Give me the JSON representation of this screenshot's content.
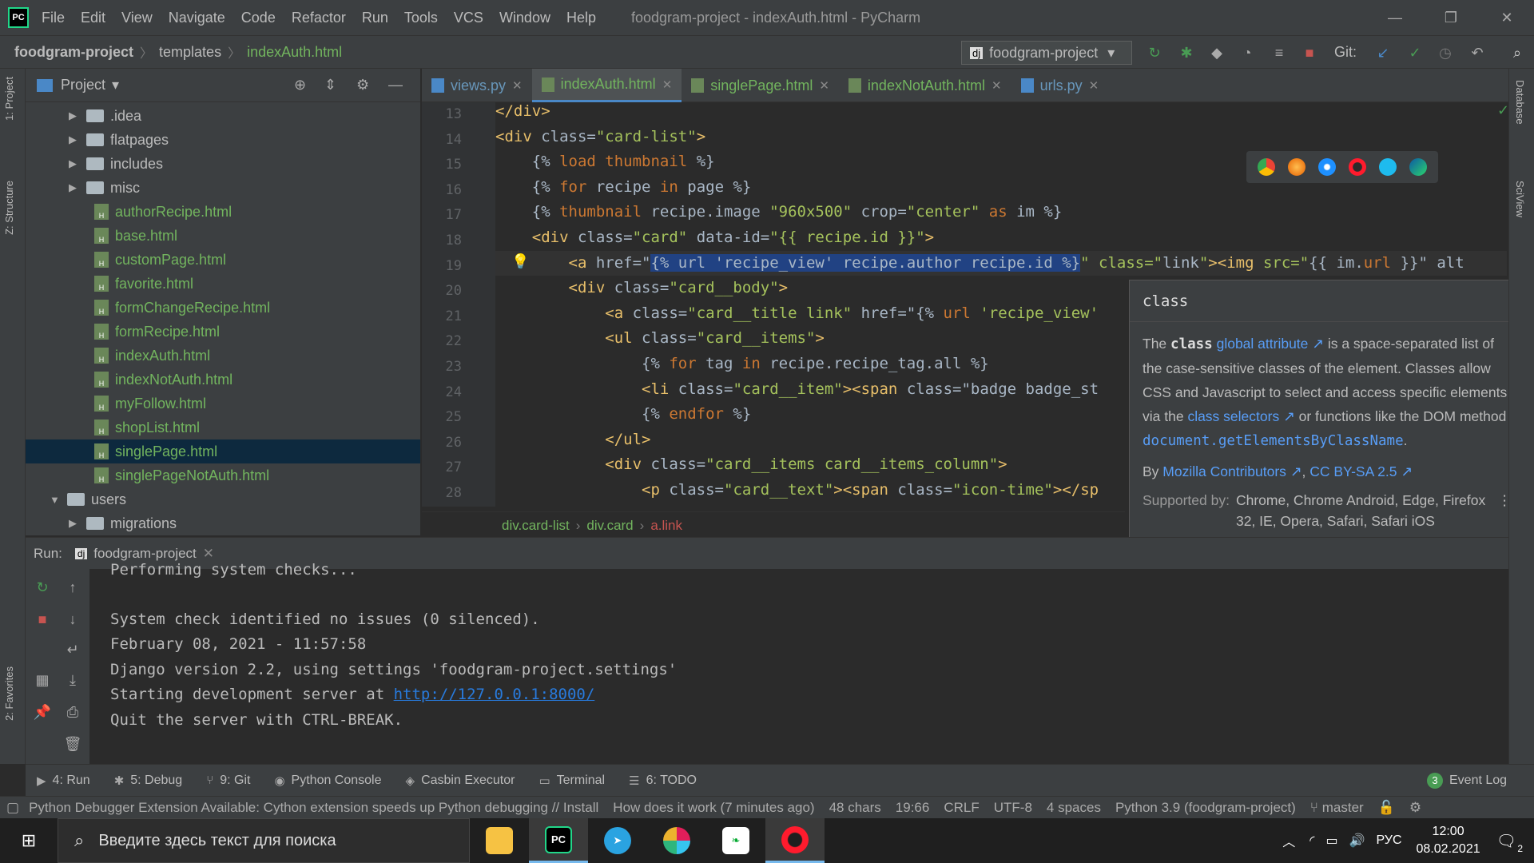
{
  "titlebar": {
    "menu": [
      "File",
      "Edit",
      "View",
      "Navigate",
      "Code",
      "Refactor",
      "Run",
      "Tools",
      "VCS",
      "Window",
      "Help"
    ],
    "window_title": "foodgram-project - indexAuth.html - PyCharm"
  },
  "navbar": {
    "crumbs": [
      "foodgram-project",
      "templates",
      "indexAuth.html"
    ],
    "run_config": "foodgram-project",
    "git_label": "Git:"
  },
  "left_strip": {
    "project_tab": "1: Project",
    "structure_tab": "Z: Structure",
    "favorites_tab": "2: Favorites"
  },
  "right_strip": {
    "database_tab": "Database",
    "sciview_tab": "SciView"
  },
  "project": {
    "title": "Project",
    "items": [
      {
        "label": ".idea",
        "type": "folder"
      },
      {
        "label": "flatpages",
        "type": "folder"
      },
      {
        "label": "includes",
        "type": "folder"
      },
      {
        "label": "misc",
        "type": "folder"
      },
      {
        "label": "authorRecipe.html",
        "type": "html"
      },
      {
        "label": "base.html",
        "type": "html"
      },
      {
        "label": "customPage.html",
        "type": "html"
      },
      {
        "label": "favorite.html",
        "type": "html"
      },
      {
        "label": "formChangeRecipe.html",
        "type": "html"
      },
      {
        "label": "formRecipe.html",
        "type": "html"
      },
      {
        "label": "indexAuth.html",
        "type": "html"
      },
      {
        "label": "indexNotAuth.html",
        "type": "html"
      },
      {
        "label": "myFollow.html",
        "type": "html"
      },
      {
        "label": "shopList.html",
        "type": "html"
      },
      {
        "label": "singlePage.html",
        "type": "html",
        "selected": true
      },
      {
        "label": "singlePageNotAuth.html",
        "type": "html"
      },
      {
        "label": "users",
        "type": "folder-open"
      },
      {
        "label": "migrations",
        "type": "folder"
      }
    ]
  },
  "editor": {
    "tabs": [
      {
        "label": "views.py",
        "kind": "py"
      },
      {
        "label": "indexAuth.html",
        "kind": "html",
        "active": true
      },
      {
        "label": "singlePage.html",
        "kind": "html"
      },
      {
        "label": "indexNotAuth.html",
        "kind": "html"
      },
      {
        "label": "urls.py",
        "kind": "py"
      }
    ],
    "line_numbers": [
      "13",
      "14",
      "15",
      "16",
      "17",
      "18",
      "19",
      "20",
      "21",
      "22",
      "23",
      "24",
      "25",
      "26",
      "27",
      "28"
    ],
    "lines": [
      "</div>",
      "<div class=\"card-list\">",
      "    {% load thumbnail %}",
      "    {% for recipe in page %}",
      "    {% thumbnail recipe.image \"960x500\" crop=\"center\" as im %}",
      "    <div class=\"card\" data-id=\"{{ recipe.id }}\">",
      "        <a href=\"{% url 'recipe_view' recipe.author recipe.id %}\" class=\"link\"><img src=\"{{ im.url }}\" alt",
      "        <div class=\"card__body\">",
      "            <a class=\"card__title link\" href=\"{% url 'recipe_view'",
      "            <ul class=\"card__items\">",
      "                {% for tag in recipe.recipe_tag.all %}",
      "                <li class=\"card__item\"><span class=\"badge badge_st",
      "                {% endfor %}",
      "            </ul>",
      "            <div class=\"card__items card__items_column\">",
      "                <p class=\"card__text\"><span class=\"icon-time\"></sp"
    ],
    "breadcrumb": [
      "div.card-list",
      "div.card",
      "a.link"
    ]
  },
  "doc_popup": {
    "title": "class",
    "p1_pre": "The ",
    "p1_bold": "class",
    "p1_link": "global attribute",
    "p1_post": " is a space-separated list of the case-sensitive classes of the element. Classes allow CSS and Javascript to select and access specific elements via the ",
    "p1_link2": "class selectors",
    "p1_post2": " or functions like the DOM method ",
    "p1_code": "document.getElementsByClassName",
    "p1_end": ".",
    "by": "By ",
    "by_link": "Mozilla Contributors",
    "license": "CC BY-SA 2.5",
    "supported_label": "Supported by:",
    "supported": "Chrome, Chrome Android, Edge, Firefox 32, IE, Opera, Safari, Safari iOS"
  },
  "run": {
    "label": "Run:",
    "tab": "foodgram-project",
    "console": [
      "Performing system checks...",
      "",
      "System check identified no issues (0 silenced).",
      "February 08, 2021 - 11:57:58",
      "Django version 2.2, using settings 'foodgram-project.settings'",
      "Starting development server at ",
      "Quit the server with CTRL-BREAK."
    ],
    "server_url": "http://127.0.0.1:8000/"
  },
  "tool_tabs": [
    "4: Run",
    "5: Debug",
    "9: Git",
    "Python Console",
    "Casbin Executor",
    "Terminal",
    "6: TODO"
  ],
  "event_log": "Event Log",
  "event_count": "3",
  "statusbar": {
    "message": "Python Debugger Extension Available: Cython extension speeds up Python debugging // Install",
    "howto": "How does it work (7 minutes ago)",
    "chars": "48 chars",
    "position": "19:66",
    "line_sep": "CRLF",
    "encoding": "UTF-8",
    "indent": "4 spaces",
    "interpreter": "Python 3.9 (foodgram-project)",
    "branch": "master"
  },
  "taskbar": {
    "search_placeholder": "Введите здесь текст для поиска",
    "lang": "РУС",
    "time": "12:00",
    "date": "08.02.2021",
    "notifications": "2"
  }
}
